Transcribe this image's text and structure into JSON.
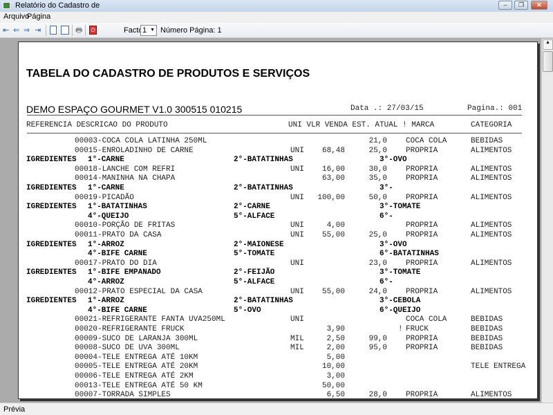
{
  "window": {
    "title": "Relatório do Cadastro de"
  },
  "menu": [
    "Arquivo",
    "Página"
  ],
  "toolbar": {
    "factor_label": "Factor:",
    "factor_value": "1",
    "page_label": "Número Página: 1",
    "icons": [
      "first-page-icon",
      "prev-page-icon",
      "next-page-icon",
      "last-page-icon",
      "single-page-icon",
      "two-page-icon",
      "print-icon",
      "close-report-icon"
    ]
  },
  "report": {
    "title": "TABELA DO CADASTRO DE PRODUTOS E SERVIÇOS",
    "company": "DEMO ESPAÇO GOURMET V1.0 300515 010215",
    "date": "Data .: 27/03/15",
    "page": "Pagina.: 001",
    "columns": "REFERENCIA DESCRICAO DO PRODUTO",
    "columns_right": "UNI VLR VENDA EST. ATUAL ! MARCA",
    "columns_cat": "CATEGORIA",
    "rows": [
      {
        "t": "p",
        "d": "00003-COCA COLA LATINHA 250ML",
        "u": "",
        "v": "",
        "e": "21,0",
        "f": "",
        "m": "COCA COLA",
        "c": "BEBIDAS"
      },
      {
        "t": "p",
        "d": "00015-ENROLADINHO DE CARNE",
        "u": "UNI",
        "v": "68,48",
        "e": "25,0",
        "f": "",
        "m": "PROPRIA",
        "c": "ALIMENTOS"
      },
      {
        "t": "i",
        "l": "IGREDIENTES",
        "a": "1°-CARNE",
        "b": "2°-BATATINHAS",
        "c": "3°-OVO"
      },
      {
        "t": "p",
        "d": "00018-LANCHE COM REFRI",
        "u": "UNI",
        "v": "16,00",
        "e": "30,0",
        "f": "",
        "m": "PROPRIA",
        "c": "ALIMENTOS"
      },
      {
        "t": "p",
        "d": "00014-MANINHA NA CHAPA",
        "u": "",
        "v": "63,00",
        "e": "35,0",
        "f": "",
        "m": "PROPRIA",
        "c": "ALIMENTOS"
      },
      {
        "t": "i",
        "l": "IGREDIENTES",
        "a": "1°-CARNE",
        "b": "2°-BATATINHAS",
        "c": "3°-"
      },
      {
        "t": "p",
        "d": "00019-PICADÃO",
        "u": "UNI",
        "v": "100,00",
        "e": "50,0",
        "f": "",
        "m": "PROPRIA",
        "c": "ALIMENTOS"
      },
      {
        "t": "i",
        "l": "IGREDIENTES",
        "a": "1°-BATATINHAS",
        "b": "2°-CARNE",
        "c": "3°-TOMATE"
      },
      {
        "t": "i",
        "l": "",
        "a": "4°-QUEIJO",
        "b": "5°-ALFACE",
        "c": "6°-"
      },
      {
        "t": "p",
        "d": "00010-PORÇÃO DE FRITAS",
        "u": "UNI",
        "v": "4,00",
        "e": "",
        "f": "",
        "m": "PROPRIA",
        "c": "ALIMENTOS"
      },
      {
        "t": "p",
        "d": "00011-PRATO DA CASA",
        "u": "UNI",
        "v": "55,00",
        "e": "25,0",
        "f": "",
        "m": "PROPRIA",
        "c": "ALIMENTOS"
      },
      {
        "t": "i",
        "l": "IGREDIENTES",
        "a": "1°-ARROZ",
        "b": "2°-MAIONESE",
        "c": "3°-OVO"
      },
      {
        "t": "i",
        "l": "",
        "a": "4°-BIFE CARNE",
        "b": "5°-TOMATE",
        "c": "6°-BATATINHAS"
      },
      {
        "t": "p",
        "d": "00017-PRATO DO DIA",
        "u": "UNI",
        "v": "",
        "e": "23,0",
        "f": "",
        "m": "PROPRIA",
        "c": "ALIMENTOS"
      },
      {
        "t": "i",
        "l": "IGREDIENTES",
        "a": "1°-BIFE EMPANADO",
        "b": "2°-FEIJÃO",
        "c": "3°-TOMATE"
      },
      {
        "t": "i",
        "l": "",
        "a": "4°-ARROZ",
        "b": "5°-ALFACE",
        "c": "6°-"
      },
      {
        "t": "p",
        "d": "00012-PRATO ESPECIAL DA CASA",
        "u": "UNI",
        "v": "55,00",
        "e": "24,0",
        "f": "",
        "m": "PROPRIA",
        "c": "ALIMENTOS"
      },
      {
        "t": "i",
        "l": "IGREDIENTES",
        "a": "1°-ARROZ",
        "b": "2°-BATATINHAS",
        "c": "3°-CEBOLA"
      },
      {
        "t": "i",
        "l": "",
        "a": "4°-BIFE CARNE",
        "b": "5°-OVO",
        "c": "6°-QUEIJO"
      },
      {
        "t": "p",
        "d": "00021-REFRIGERANTE FANTA UVA250ML",
        "u": "UNI",
        "v": "",
        "e": "",
        "f": "",
        "m": "COCA COLA",
        "c": "BEBIDAS"
      },
      {
        "t": "p",
        "d": "00020-REFRIGERANTE FRUCK",
        "u": "",
        "v": "3,90",
        "e": "",
        "f": "!",
        "m": "FRUCK",
        "c": "BEBIDAS"
      },
      {
        "t": "p",
        "d": "00009-SUCO DE LARANJA 300ML",
        "u": "MIL",
        "v": "2,50",
        "e": "99,0",
        "f": "",
        "m": "PROPRIA",
        "c": "BEBIDAS"
      },
      {
        "t": "p",
        "d": "00008-SUCO DE UVA 300ML",
        "u": "MIL",
        "v": "2,00",
        "e": "95,0",
        "f": "",
        "m": "PROPRIA",
        "c": "BEBIDAS"
      },
      {
        "t": "p",
        "d": "00004-TELE ENTREGA ATÉ 10KM",
        "u": "",
        "v": "5,00",
        "e": "",
        "f": "",
        "m": "",
        "c": ""
      },
      {
        "t": "p",
        "d": "00005-TELE ENTREGA ATÉ 20KM",
        "u": "",
        "v": "10,00",
        "e": "",
        "f": "",
        "m": "",
        "c": "TELE ENTREGA"
      },
      {
        "t": "p",
        "d": "00006-TELE ENTREGA ATÉ 2KM",
        "u": "",
        "v": "3,00",
        "e": "",
        "f": "",
        "m": "",
        "c": ""
      },
      {
        "t": "p",
        "d": "00013-TELE ENTREGA ATÉ 50 KM",
        "u": "",
        "v": "50,00",
        "e": "",
        "f": "",
        "m": "",
        "c": ""
      },
      {
        "t": "p",
        "d": "00007-TORRADA SIMPLES",
        "u": "",
        "v": "6,50",
        "e": "28,0",
        "f": "",
        "m": "PROPRIA",
        "c": "ALIMENTOS"
      }
    ]
  },
  "status": {
    "text": "Prévia"
  }
}
